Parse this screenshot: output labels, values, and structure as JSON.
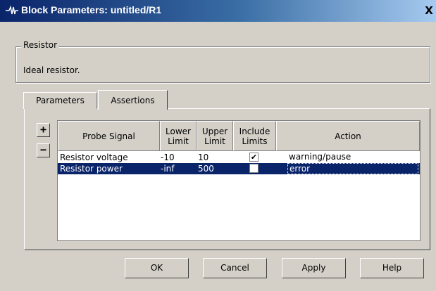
{
  "window": {
    "title": "Block Parameters: untitled/R1",
    "close_glyph": "X"
  },
  "group": {
    "legend": "Resistor",
    "description": "Ideal resistor."
  },
  "tabs": [
    {
      "label": "Parameters",
      "selected": false
    },
    {
      "label": "Assertions",
      "selected": true
    }
  ],
  "side_buttons": {
    "add": "+",
    "remove": "−"
  },
  "table": {
    "columns": [
      {
        "line1": "Probe Signal",
        "line2": ""
      },
      {
        "line1": "Lower",
        "line2": "Limit"
      },
      {
        "line1": "Upper",
        "line2": "Limit"
      },
      {
        "line1": "Include",
        "line2": "Limits"
      },
      {
        "line1": "Action",
        "line2": ""
      }
    ],
    "rows": [
      {
        "signal": "Resistor voltage",
        "lower": "-10",
        "upper": "10",
        "include": true,
        "include_glyph": "✔",
        "action": "warning/pause",
        "selected": false
      },
      {
        "signal": "Resistor power",
        "lower": "-inf",
        "upper": "500",
        "include": false,
        "include_glyph": "",
        "action": "error",
        "selected": true
      }
    ]
  },
  "footer": {
    "ok": "OK",
    "cancel": "Cancel",
    "apply": "Apply",
    "help": "Help"
  },
  "colors": {
    "dialog_face": "#d4d0c8",
    "title_gradient_start": "#0a246a",
    "selection": "#0a246a"
  }
}
